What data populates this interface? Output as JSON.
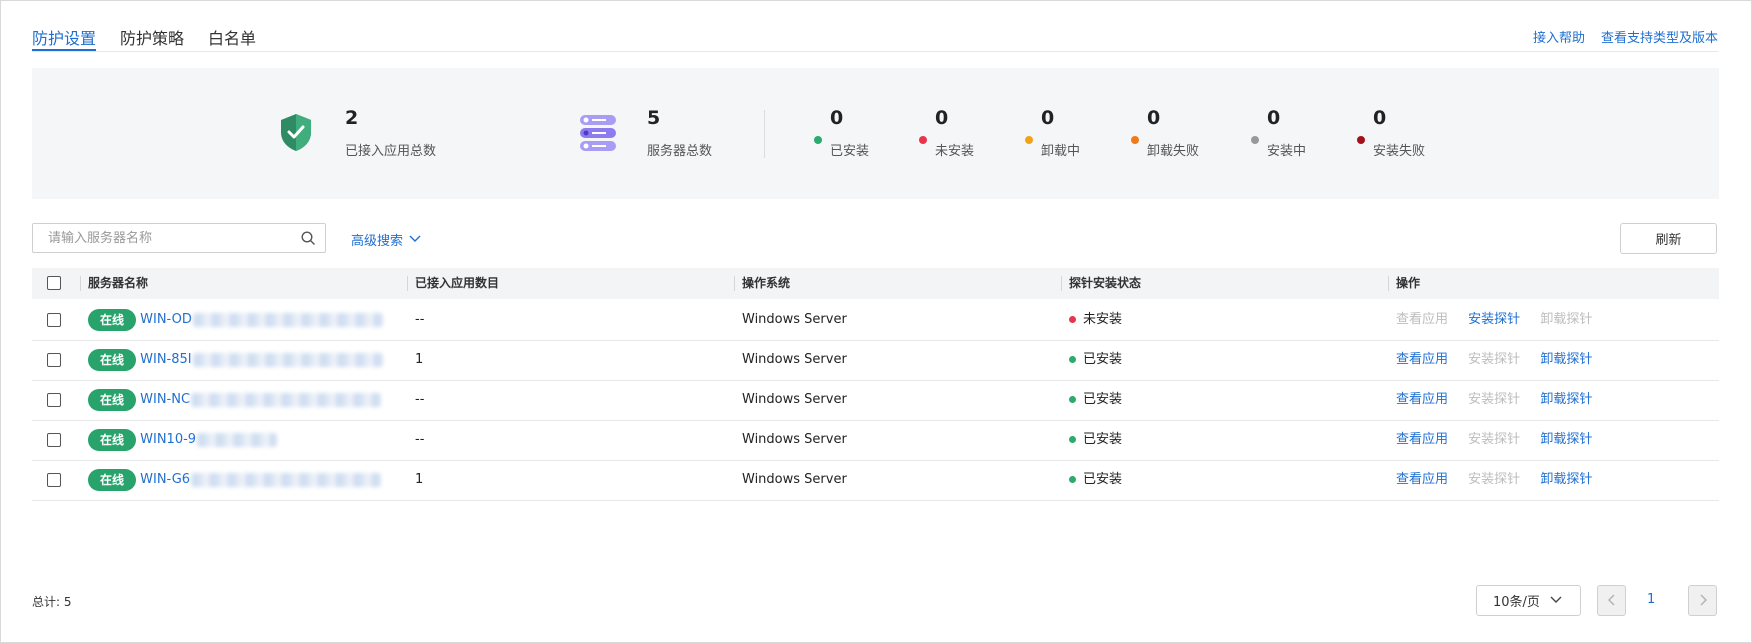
{
  "tabs": [
    {
      "label": "防护设置",
      "active": true
    },
    {
      "label": "防护策略",
      "active": false
    },
    {
      "label": "白名单",
      "active": false
    }
  ],
  "top_links": {
    "help": "接入帮助",
    "support": "查看支持类型及版本"
  },
  "summary": {
    "apps": {
      "value": "2",
      "label": "已接入应用总数",
      "icon": "shield-check-icon"
    },
    "servers": {
      "value": "5",
      "label": "服务器总数",
      "icon": "server-stack-icon"
    },
    "statuses": [
      {
        "value": "0",
        "label": "已安装",
        "color": "#2bab6c"
      },
      {
        "value": "0",
        "label": "未安装",
        "color": "#e8344d"
      },
      {
        "value": "0",
        "label": "卸载中",
        "color": "#f0a318"
      },
      {
        "value": "0",
        "label": "卸载失败",
        "color": "#ef7a1a"
      },
      {
        "value": "0",
        "label": "安装中",
        "color": "#999999"
      },
      {
        "value": "0",
        "label": "安装失败",
        "color": "#a3121b"
      }
    ]
  },
  "search": {
    "placeholder": "请输入服务器名称",
    "advanced_label": "高级搜索",
    "refresh_label": "刷新"
  },
  "table": {
    "columns": [
      "服务器名称",
      "已接入应用数目",
      "操作系统",
      "探针安装状态",
      "操作"
    ],
    "rows": [
      {
        "online": "在线",
        "name": "WIN-OD",
        "apps": "--",
        "os": "Windows Server",
        "status": "未安装",
        "status_color": "#e8344d",
        "actions": [
          {
            "label": "查看应用",
            "enabled": false
          },
          {
            "label": "安装探针",
            "enabled": true
          },
          {
            "label": "卸载探针",
            "enabled": false
          }
        ]
      },
      {
        "online": "在线",
        "name": "WIN-85I",
        "apps": "1",
        "os": "Windows Server",
        "status": "已安装",
        "status_color": "#2bab6c",
        "actions": [
          {
            "label": "查看应用",
            "enabled": true
          },
          {
            "label": "安装探针",
            "enabled": false
          },
          {
            "label": "卸载探针",
            "enabled": true
          }
        ]
      },
      {
        "online": "在线",
        "name": "WIN-NC",
        "apps": "--",
        "os": "Windows Server",
        "status": "已安装",
        "status_color": "#2bab6c",
        "actions": [
          {
            "label": "查看应用",
            "enabled": true
          },
          {
            "label": "安装探针",
            "enabled": false
          },
          {
            "label": "卸载探针",
            "enabled": true
          }
        ]
      },
      {
        "online": "在线",
        "name": "WIN10-9",
        "apps": "--",
        "os": "Windows Server",
        "status": "已安装",
        "status_color": "#2bab6c",
        "actions": [
          {
            "label": "查看应用",
            "enabled": true
          },
          {
            "label": "安装探针",
            "enabled": false
          },
          {
            "label": "卸载探针",
            "enabled": true
          }
        ]
      },
      {
        "online": "在线",
        "name": "WIN-G6",
        "apps": "1",
        "os": "Windows Server",
        "status": "已安装",
        "status_color": "#2bab6c",
        "actions": [
          {
            "label": "查看应用",
            "enabled": true
          },
          {
            "label": "安装探针",
            "enabled": false
          },
          {
            "label": "卸载探针",
            "enabled": true
          }
        ]
      }
    ]
  },
  "footer": {
    "total": "总计: 5",
    "page_size": "10条/页",
    "current_page": "1"
  }
}
